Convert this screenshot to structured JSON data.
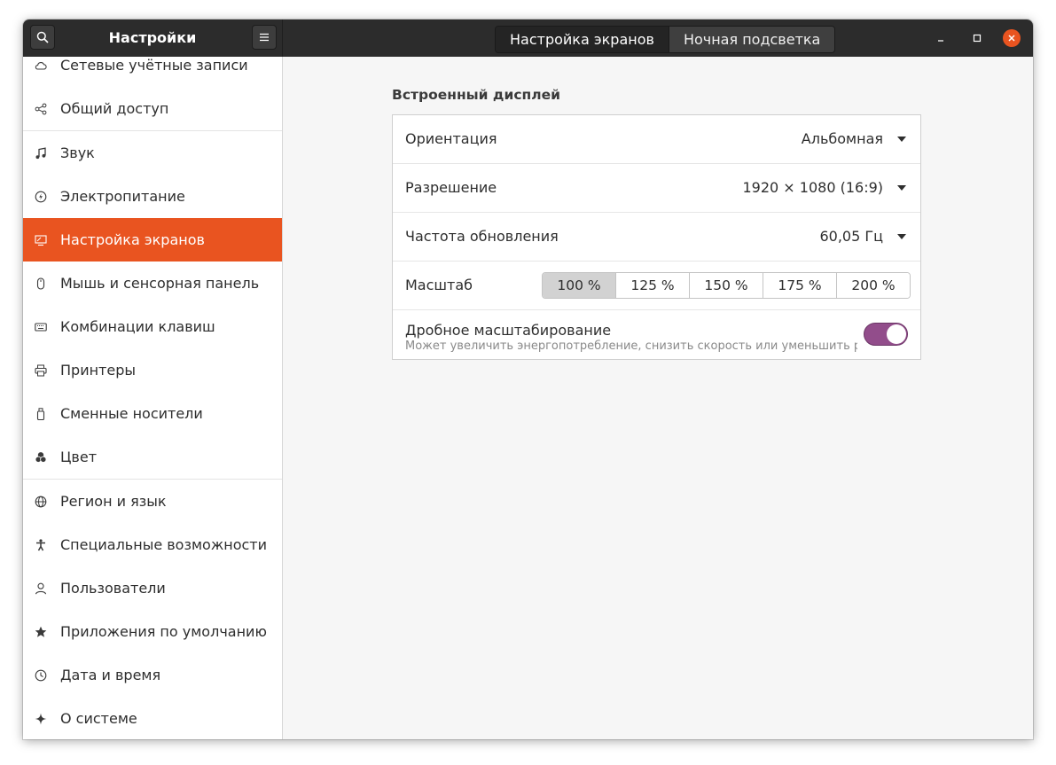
{
  "app": {
    "title": "Настройки"
  },
  "header": {
    "tabs": [
      {
        "label": "Настройка экранов",
        "active": true
      },
      {
        "label": "Ночная подсветка",
        "active": false
      }
    ]
  },
  "sidebar": {
    "items": [
      {
        "label": "Сетевые учётные записи",
        "icon": "cloud-icon"
      },
      {
        "label": "Общий доступ",
        "icon": "share-icon"
      },
      {
        "label": "Звук",
        "icon": "music-note-icon"
      },
      {
        "label": "Электропитание",
        "icon": "power-icon"
      },
      {
        "label": "Настройка экранов",
        "icon": "display-icon",
        "active": true
      },
      {
        "label": "Мышь и сенсорная панель",
        "icon": "mouse-icon"
      },
      {
        "label": "Комбинации клавиш",
        "icon": "keyboard-icon"
      },
      {
        "label": "Принтеры",
        "icon": "printer-icon"
      },
      {
        "label": "Сменные носители",
        "icon": "usb-drive-icon"
      },
      {
        "label": "Цвет",
        "icon": "color-icon"
      },
      {
        "label": "Регион и язык",
        "icon": "globe-icon"
      },
      {
        "label": "Специальные возможности",
        "icon": "accessibility-icon"
      },
      {
        "label": "Пользователи",
        "icon": "user-icon"
      },
      {
        "label": "Приложения по умолчанию",
        "icon": "star-icon"
      },
      {
        "label": "Дата и время",
        "icon": "clock-icon"
      },
      {
        "label": "О системе",
        "icon": "sparkle-icon"
      }
    ]
  },
  "display": {
    "section_title": "Встроенный дисплей",
    "orientation": {
      "label": "Ориентация",
      "value": "Альбомная"
    },
    "resolution": {
      "label": "Разрешение",
      "value": "1920 × 1080 (16:9)"
    },
    "refresh": {
      "label": "Частота обновления",
      "value": "60,05 Гц"
    },
    "scale": {
      "label": "Масштаб",
      "options": [
        "100 %",
        "125 %",
        "150 %",
        "175 %",
        "200 %"
      ],
      "selected": "100 %"
    },
    "fractional": {
      "label": "Дробное масштабирование",
      "sublabel": "Может увеличить энергопотребление, снизить скорость или уменьшить рез…",
      "enabled": true
    }
  },
  "colors": {
    "accent": "#e95420",
    "toggle_on": "#924d8b",
    "titlebar": "#2c2c2c"
  }
}
